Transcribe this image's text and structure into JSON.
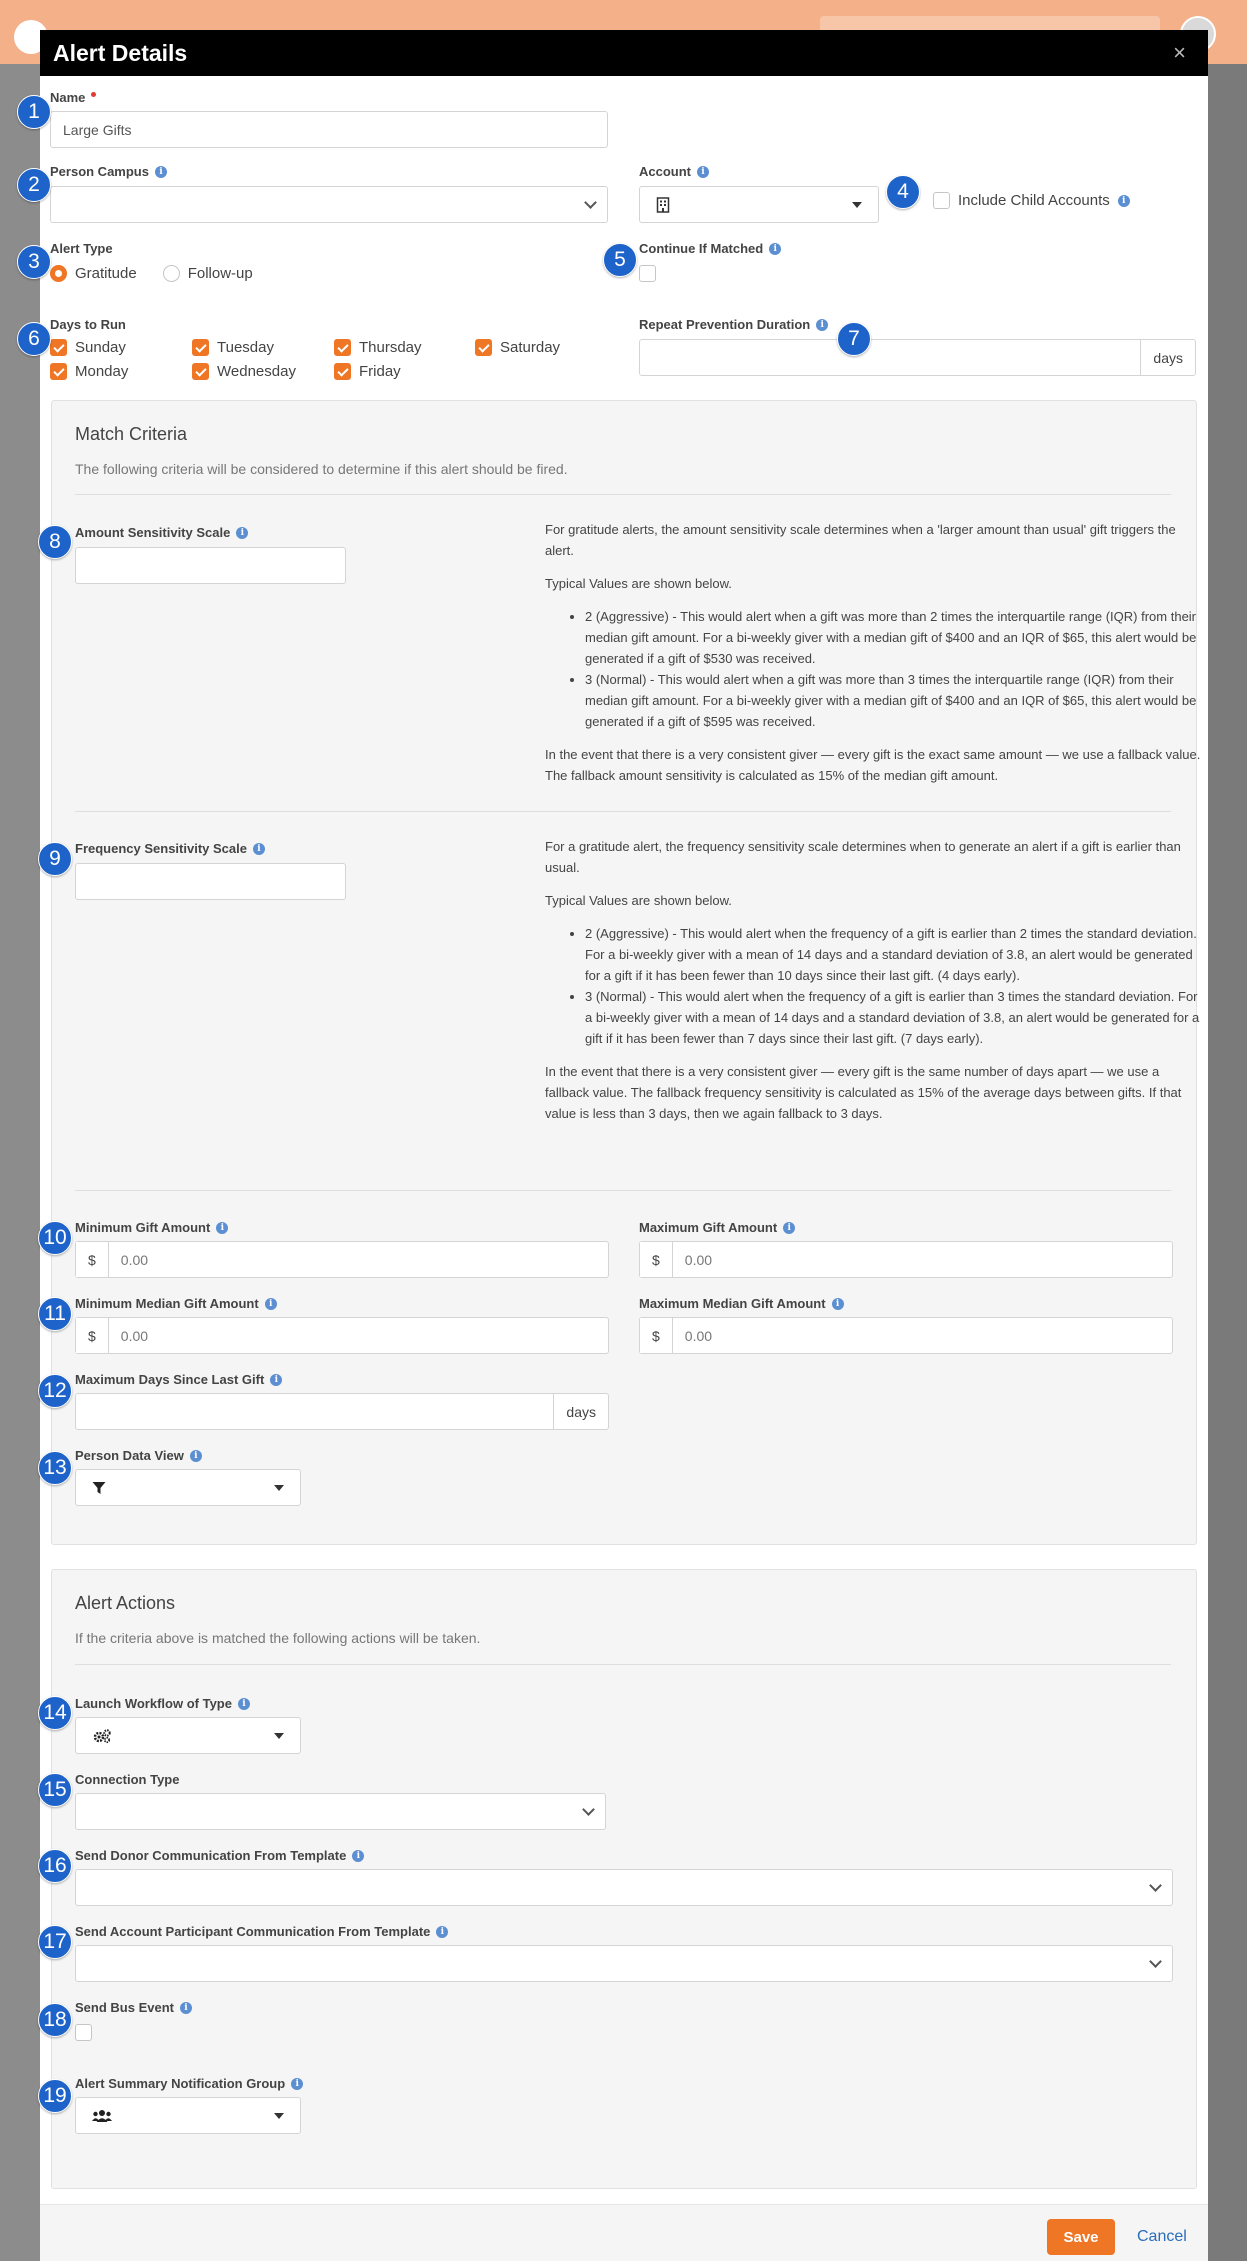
{
  "modal": {
    "title": "Alert Details",
    "close": "×"
  },
  "fields": {
    "name": {
      "label": "Name",
      "value": "Large Gifts"
    },
    "person_campus": {
      "label": "Person Campus",
      "value": ""
    },
    "account": {
      "label": "Account",
      "value": ""
    },
    "include_child": {
      "label": "Include Child Accounts",
      "checked": false
    },
    "alert_type": {
      "label": "Alert Type",
      "options": [
        "Gratitude",
        "Follow-up"
      ],
      "selected": "Gratitude"
    },
    "continue_matched": {
      "label": "Continue If Matched",
      "checked": false
    },
    "days_to_run": {
      "label": "Days to Run",
      "days": [
        "Sunday",
        "Monday",
        "Tuesday",
        "Wednesday",
        "Thursday",
        "Friday",
        "Saturday"
      ]
    },
    "repeat_prevention": {
      "label": "Repeat Prevention Duration",
      "value": "",
      "suffix": "days"
    }
  },
  "match": {
    "title": "Match Criteria",
    "subtitle": "The following criteria will be considered to determine if this alert should be fired.",
    "amount": {
      "label": "Amount Sensitivity Scale",
      "help_intro": "For gratitude alerts, the amount sensitivity scale determines when a 'larger amount than usual' gift triggers the alert.",
      "help_typical": "Typical Values are shown below.",
      "help_b1": "2 (Aggressive) - This would alert when a gift was more than 2 times the interquartile range (IQR) from their median gift amount. For a bi-weekly giver with a median gift of $400 and an IQR of $65, this alert would be generated if a gift of $530 was received.",
      "help_b2": "3 (Normal) - This would alert when a gift was more than 3 times the interquartile range (IQR) from their median gift amount. For a bi-weekly giver with a median gift of $400 and an IQR of $65, this alert would be generated if a gift of $595 was received.",
      "help_outro": "In the event that there is a very consistent giver — every gift is the exact same amount — we use a fallback value. The fallback amount sensitivity is calculated as 15% of the median gift amount."
    },
    "frequency": {
      "label": "Frequency Sensitivity Scale",
      "help_intro": "For a gratitude alert, the frequency sensitivity scale determines when to generate an alert if a gift is earlier than usual.",
      "help_typical": "Typical Values are shown below.",
      "help_b1": "2 (Aggressive) - This would alert when the frequency of a gift is earlier than 2 times the standard deviation. For a bi-weekly giver with a mean of 14 days and a standard deviation of 3.8, an alert would be generated for a gift if it has been fewer than 10 days since their last gift. (4 days early).",
      "help_b2": "3 (Normal) - This would alert when the frequency of a gift is earlier than 3 times the standard deviation. For a bi-weekly giver with a mean of 14 days and a standard deviation of 3.8, an alert would be generated for a gift if it has been fewer than 7 days since their last gift. (7 days early).",
      "help_outro": "In the event that there is a very consistent giver — every gift is the same number of days apart — we use a fallback value. The fallback frequency sensitivity is calculated as 15% of the average days between gifts. If that value is less than 3 days, then we again fallback to 3 days."
    },
    "min_gift": {
      "label": "Minimum Gift Amount",
      "prefix": "$",
      "placeholder": "0.00"
    },
    "max_gift": {
      "label": "Maximum Gift Amount",
      "prefix": "$",
      "placeholder": "0.00"
    },
    "min_median": {
      "label": "Minimum Median Gift Amount",
      "prefix": "$",
      "placeholder": "0.00"
    },
    "max_median": {
      "label": "Maximum Median Gift Amount",
      "prefix": "$",
      "placeholder": "0.00"
    },
    "max_days": {
      "label": "Maximum Days Since Last Gift",
      "suffix": "days"
    },
    "data_view": {
      "label": "Person Data View"
    }
  },
  "actions": {
    "title": "Alert Actions",
    "subtitle": "If the criteria above is matched the following actions will be taken.",
    "workflow": {
      "label": "Launch Workflow of Type"
    },
    "connection": {
      "label": "Connection Type"
    },
    "donor_comm": {
      "label": "Send Donor Communication From Template"
    },
    "participant_comm": {
      "label": "Send Account Participant Communication From Template"
    },
    "bus_event": {
      "label": "Send Bus Event"
    },
    "summary_group": {
      "label": "Alert Summary Notification Group"
    }
  },
  "footer": {
    "save": "Save",
    "cancel": "Cancel"
  },
  "badges": [
    "1",
    "2",
    "3",
    "4",
    "5",
    "6",
    "7",
    "8",
    "9",
    "10",
    "11",
    "12",
    "13",
    "14",
    "15",
    "16",
    "17",
    "18",
    "19"
  ],
  "colors": {
    "accent": "#ee7625",
    "badge": "#1e63c9",
    "header": "#000000",
    "link": "#2a6db8"
  }
}
